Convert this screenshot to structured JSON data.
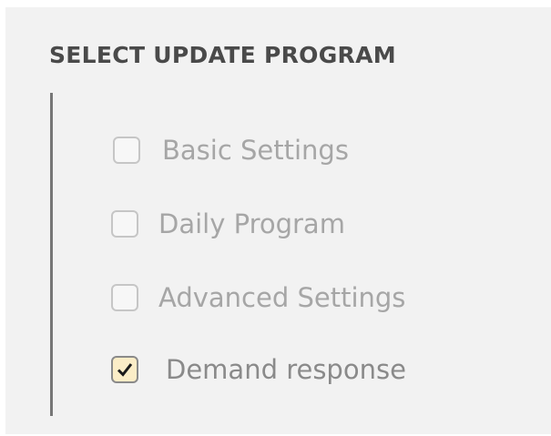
{
  "section": {
    "title": "SELECT UPDATE PROGRAM"
  },
  "options": [
    {
      "label": "Basic Settings",
      "checked": false
    },
    {
      "label": "Daily Program",
      "checked": false
    },
    {
      "label": "Advanced Settings",
      "checked": false
    },
    {
      "label": "Demand response",
      "checked": true
    }
  ],
  "colors": {
    "panel_background": "#f2f2f2",
    "checked_fill": "#fbedc7",
    "label_text": "#a6a6a6",
    "title_text": "#4a4a4a"
  }
}
